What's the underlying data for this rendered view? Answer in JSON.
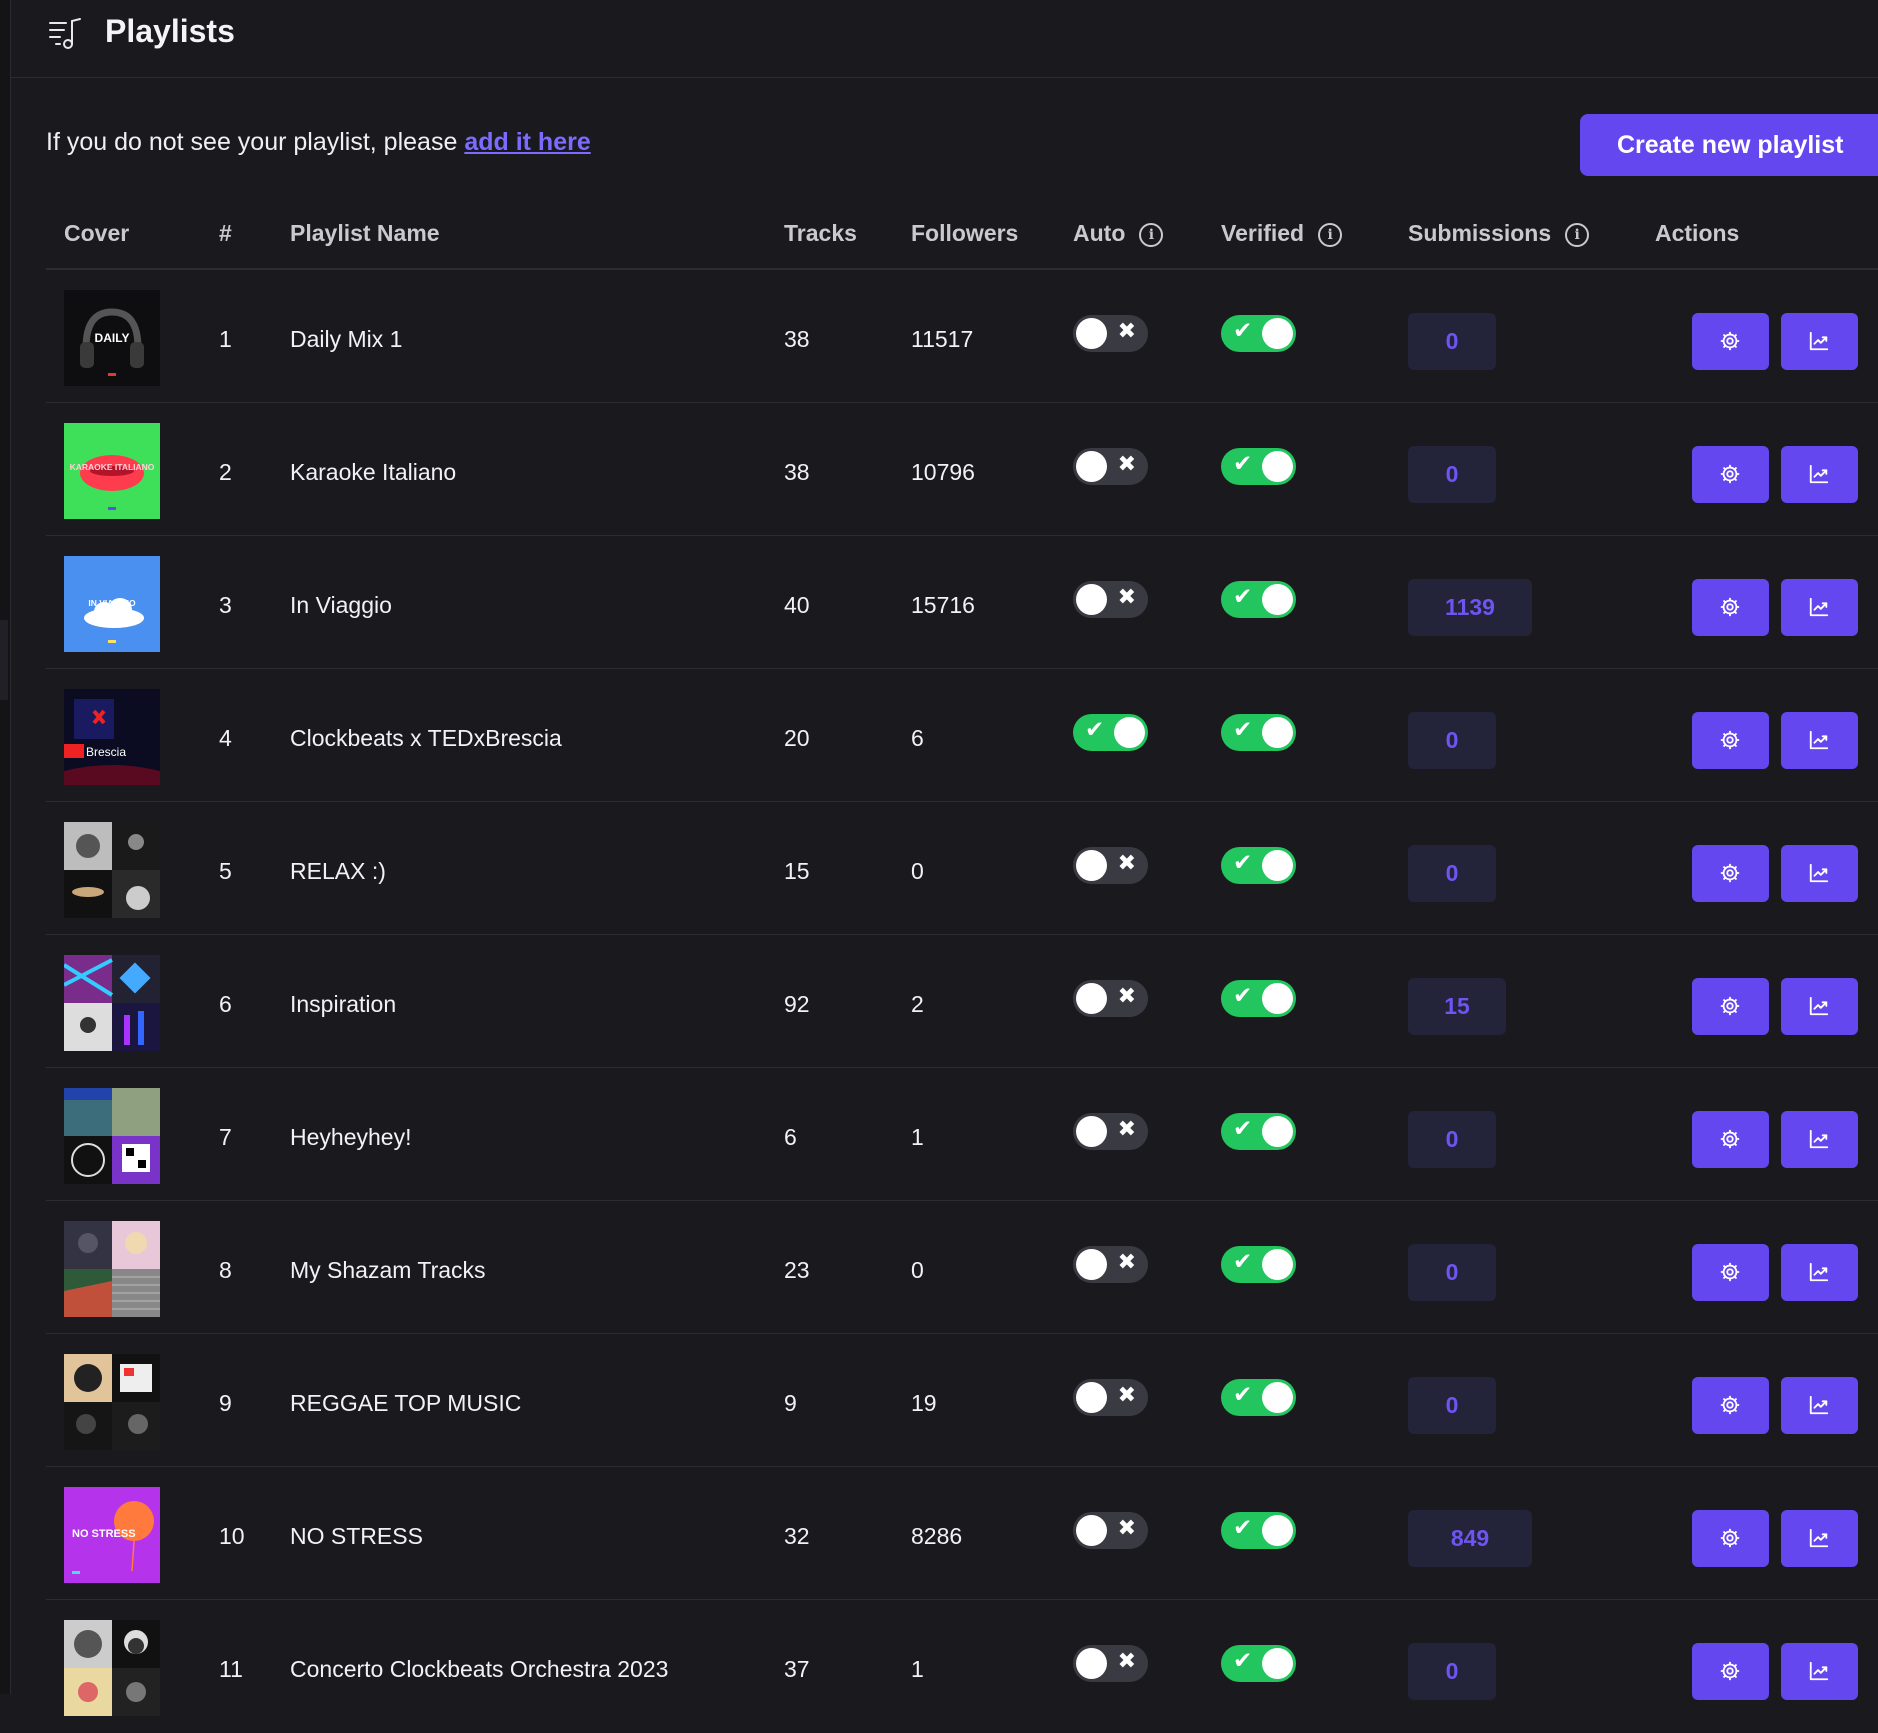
{
  "header": {
    "title": "Playlists"
  },
  "notice": {
    "text": "If you do not see your playlist, please ",
    "link": "add it here"
  },
  "create_button": "Create new playlist",
  "columns": {
    "cover": "Cover",
    "num": "#",
    "name": "Playlist Name",
    "tracks": "Tracks",
    "followers": "Followers",
    "auto": "Auto",
    "verified": "Verified",
    "submissions": "Submissions",
    "actions": "Actions"
  },
  "icons": {
    "title": "playlist-music-icon",
    "info": "info-icon",
    "settings": "gear-icon",
    "stats": "chart-line-icon"
  },
  "colors": {
    "accent": "#6547f0",
    "toggle_on": "#22c55e",
    "toggle_off": "#3a3a42",
    "background": "#1a1a1e"
  },
  "rows": [
    {
      "num": "1",
      "name": "Daily Mix 1",
      "tracks": "38",
      "followers": "11517",
      "auto": false,
      "verified": true,
      "submissions": "0",
      "cover_text": "DAILY",
      "cover_style": "daily"
    },
    {
      "num": "2",
      "name": "Karaoke Italiano",
      "tracks": "38",
      "followers": "10796",
      "auto": false,
      "verified": true,
      "submissions": "0",
      "cover_text": "KARAOKE ITALIANO",
      "cover_style": "karaoke"
    },
    {
      "num": "3",
      "name": "In Viaggio",
      "tracks": "40",
      "followers": "15716",
      "auto": false,
      "verified": true,
      "submissions": "1139",
      "cover_text": "IN VIAGGIO",
      "cover_style": "viaggio"
    },
    {
      "num": "4",
      "name": "Clockbeats x TEDxBrescia",
      "tracks": "20",
      "followers": "6",
      "auto": true,
      "verified": true,
      "submissions": "0",
      "cover_text": "Brescia",
      "cover_style": "ted"
    },
    {
      "num": "5",
      "name": "RELAX :)",
      "tracks": "15",
      "followers": "0",
      "auto": false,
      "verified": true,
      "submissions": "0",
      "cover_text": "",
      "cover_style": "relax"
    },
    {
      "num": "6",
      "name": "Inspiration",
      "tracks": "92",
      "followers": "2",
      "auto": false,
      "verified": true,
      "submissions": "15",
      "cover_text": "",
      "cover_style": "inspiration"
    },
    {
      "num": "7",
      "name": "Heyheyhey!",
      "tracks": "6",
      "followers": "1",
      "auto": false,
      "verified": true,
      "submissions": "0",
      "cover_text": "",
      "cover_style": "hey"
    },
    {
      "num": "8",
      "name": "My Shazam Tracks",
      "tracks": "23",
      "followers": "0",
      "auto": false,
      "verified": true,
      "submissions": "0",
      "cover_text": "",
      "cover_style": "shazam"
    },
    {
      "num": "9",
      "name": "REGGAE TOP MUSIC",
      "tracks": "9",
      "followers": "19",
      "auto": false,
      "verified": true,
      "submissions": "0",
      "cover_text": "",
      "cover_style": "reggae"
    },
    {
      "num": "10",
      "name": "NO STRESS",
      "tracks": "32",
      "followers": "8286",
      "auto": false,
      "verified": true,
      "submissions": "849",
      "cover_text": "NO STRESS",
      "cover_style": "nostress"
    },
    {
      "num": "11",
      "name": "Concerto Clockbeats Orchestra 2023",
      "tracks": "37",
      "followers": "1",
      "auto": false,
      "verified": true,
      "submissions": "0",
      "cover_text": "",
      "cover_style": "concerto"
    }
  ]
}
